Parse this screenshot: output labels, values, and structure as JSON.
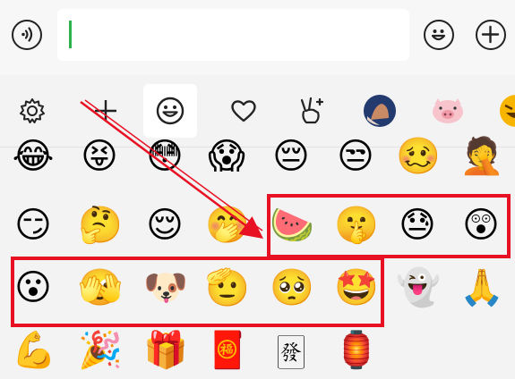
{
  "input_bar": {
    "voice_icon": "voice-icon",
    "text_value": "",
    "emoji_icon": "emoji-face-icon",
    "plus_icon": "plus-icon"
  },
  "categories": [
    {
      "icon": "settings-gear-icon"
    },
    {
      "icon": "add-icon"
    },
    {
      "icon": "smiley-face-icon",
      "active": true
    },
    {
      "icon": "heart-icon"
    },
    {
      "icon": "victory-hand-icon"
    },
    {
      "icon": "sticker-photo-icon"
    },
    {
      "icon": "pig-sticker-icon"
    },
    {
      "icon": "laughing-sticker-icon"
    }
  ],
  "emoji_rows": [
    [
      "😂",
      "😝",
      "😳",
      "😱",
      "😔",
      "😒",
      "🥴",
      "🤦"
    ],
    [
      "😏",
      "🤔",
      "😌",
      "🤭",
      "🍉",
      "🤫",
      "😓",
      "😲"
    ],
    [
      "😮",
      "🫣",
      "🐶",
      "🫡",
      "🥺",
      "🤩",
      "👻",
      "🙏"
    ],
    [
      "💪",
      "🎉",
      "🎁",
      "🧧",
      "🀅",
      "🏮"
    ]
  ],
  "colors": {
    "highlight_box": "#e81123",
    "arrow": "#e81123",
    "caret": "#2bb24c"
  }
}
